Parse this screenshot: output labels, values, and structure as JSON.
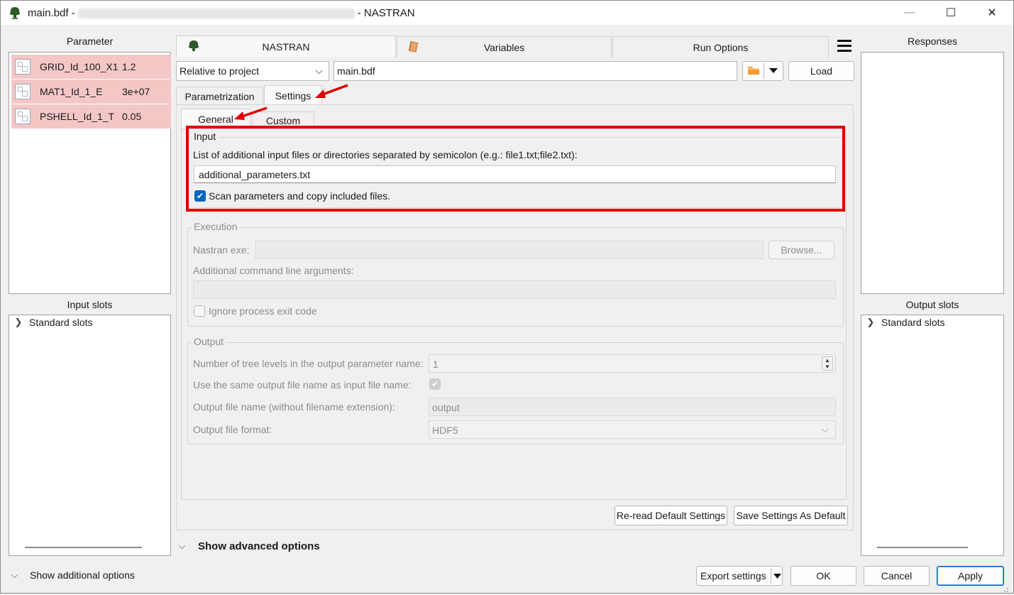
{
  "window": {
    "title_file": "main.bdf -",
    "title_app": "- NASTRAN",
    "minimize": "—",
    "maximize": "☐",
    "close": "✕"
  },
  "left": {
    "parameter_title": "Parameter",
    "parameters": [
      {
        "name": "GRID_Id_100_X1",
        "value": "1.2"
      },
      {
        "name": "MAT1_Id_1_E",
        "value": "3e+07"
      },
      {
        "name": "PSHELL_Id_1_T",
        "value": "0.05"
      }
    ],
    "input_slots_title": "Input slots",
    "input_slots_item": "Standard slots"
  },
  "right": {
    "responses_title": "Responses",
    "output_slots_title": "Output slots",
    "output_slots_item": "Standard slots"
  },
  "tabs": {
    "nastran": "NASTRAN",
    "variables": "Variables",
    "run_options": "Run Options"
  },
  "toolbar": {
    "path_mode": "Relative to project",
    "file": "main.bdf",
    "load": "Load"
  },
  "subtabs": {
    "parametrization": "Parametrization",
    "settings": "Settings",
    "general": "General",
    "custom": "Custom"
  },
  "input_group": {
    "title": "Input",
    "description": "List of additional input files or directories separated by semicolon (e.g.: file1.txt;file2.txt):",
    "value": "additional_parameters.txt",
    "scan_label": "Scan parameters and copy included files."
  },
  "execution_group": {
    "title": "Execution",
    "nastran_exe_label": "Nastran exe:",
    "browse": "Browse...",
    "args_label": "Additional command line arguments:",
    "ignore_exit_label": "Ignore process exit code"
  },
  "output_group": {
    "title": "Output",
    "tree_levels_label": "Number of tree levels in the output parameter name:",
    "tree_levels_value": "1",
    "same_name_label": "Use the same output file name as input file name:",
    "output_name_label": "Output file name (without filename extension):",
    "output_name_value": "output",
    "format_label": "Output file format:",
    "format_value": "HDF5"
  },
  "buttons": {
    "reread_defaults": "Re-read Default Settings",
    "save_defaults": "Save Settings As Default",
    "show_advanced": "Show advanced options",
    "show_additional": "Show additional options",
    "export_settings": "Export settings",
    "ok": "OK",
    "cancel": "Cancel",
    "apply": "Apply"
  },
  "colors": {
    "param_highlight": "#f4c7c7",
    "annotation_red": "#e00000",
    "accent_blue": "#0067c0"
  }
}
